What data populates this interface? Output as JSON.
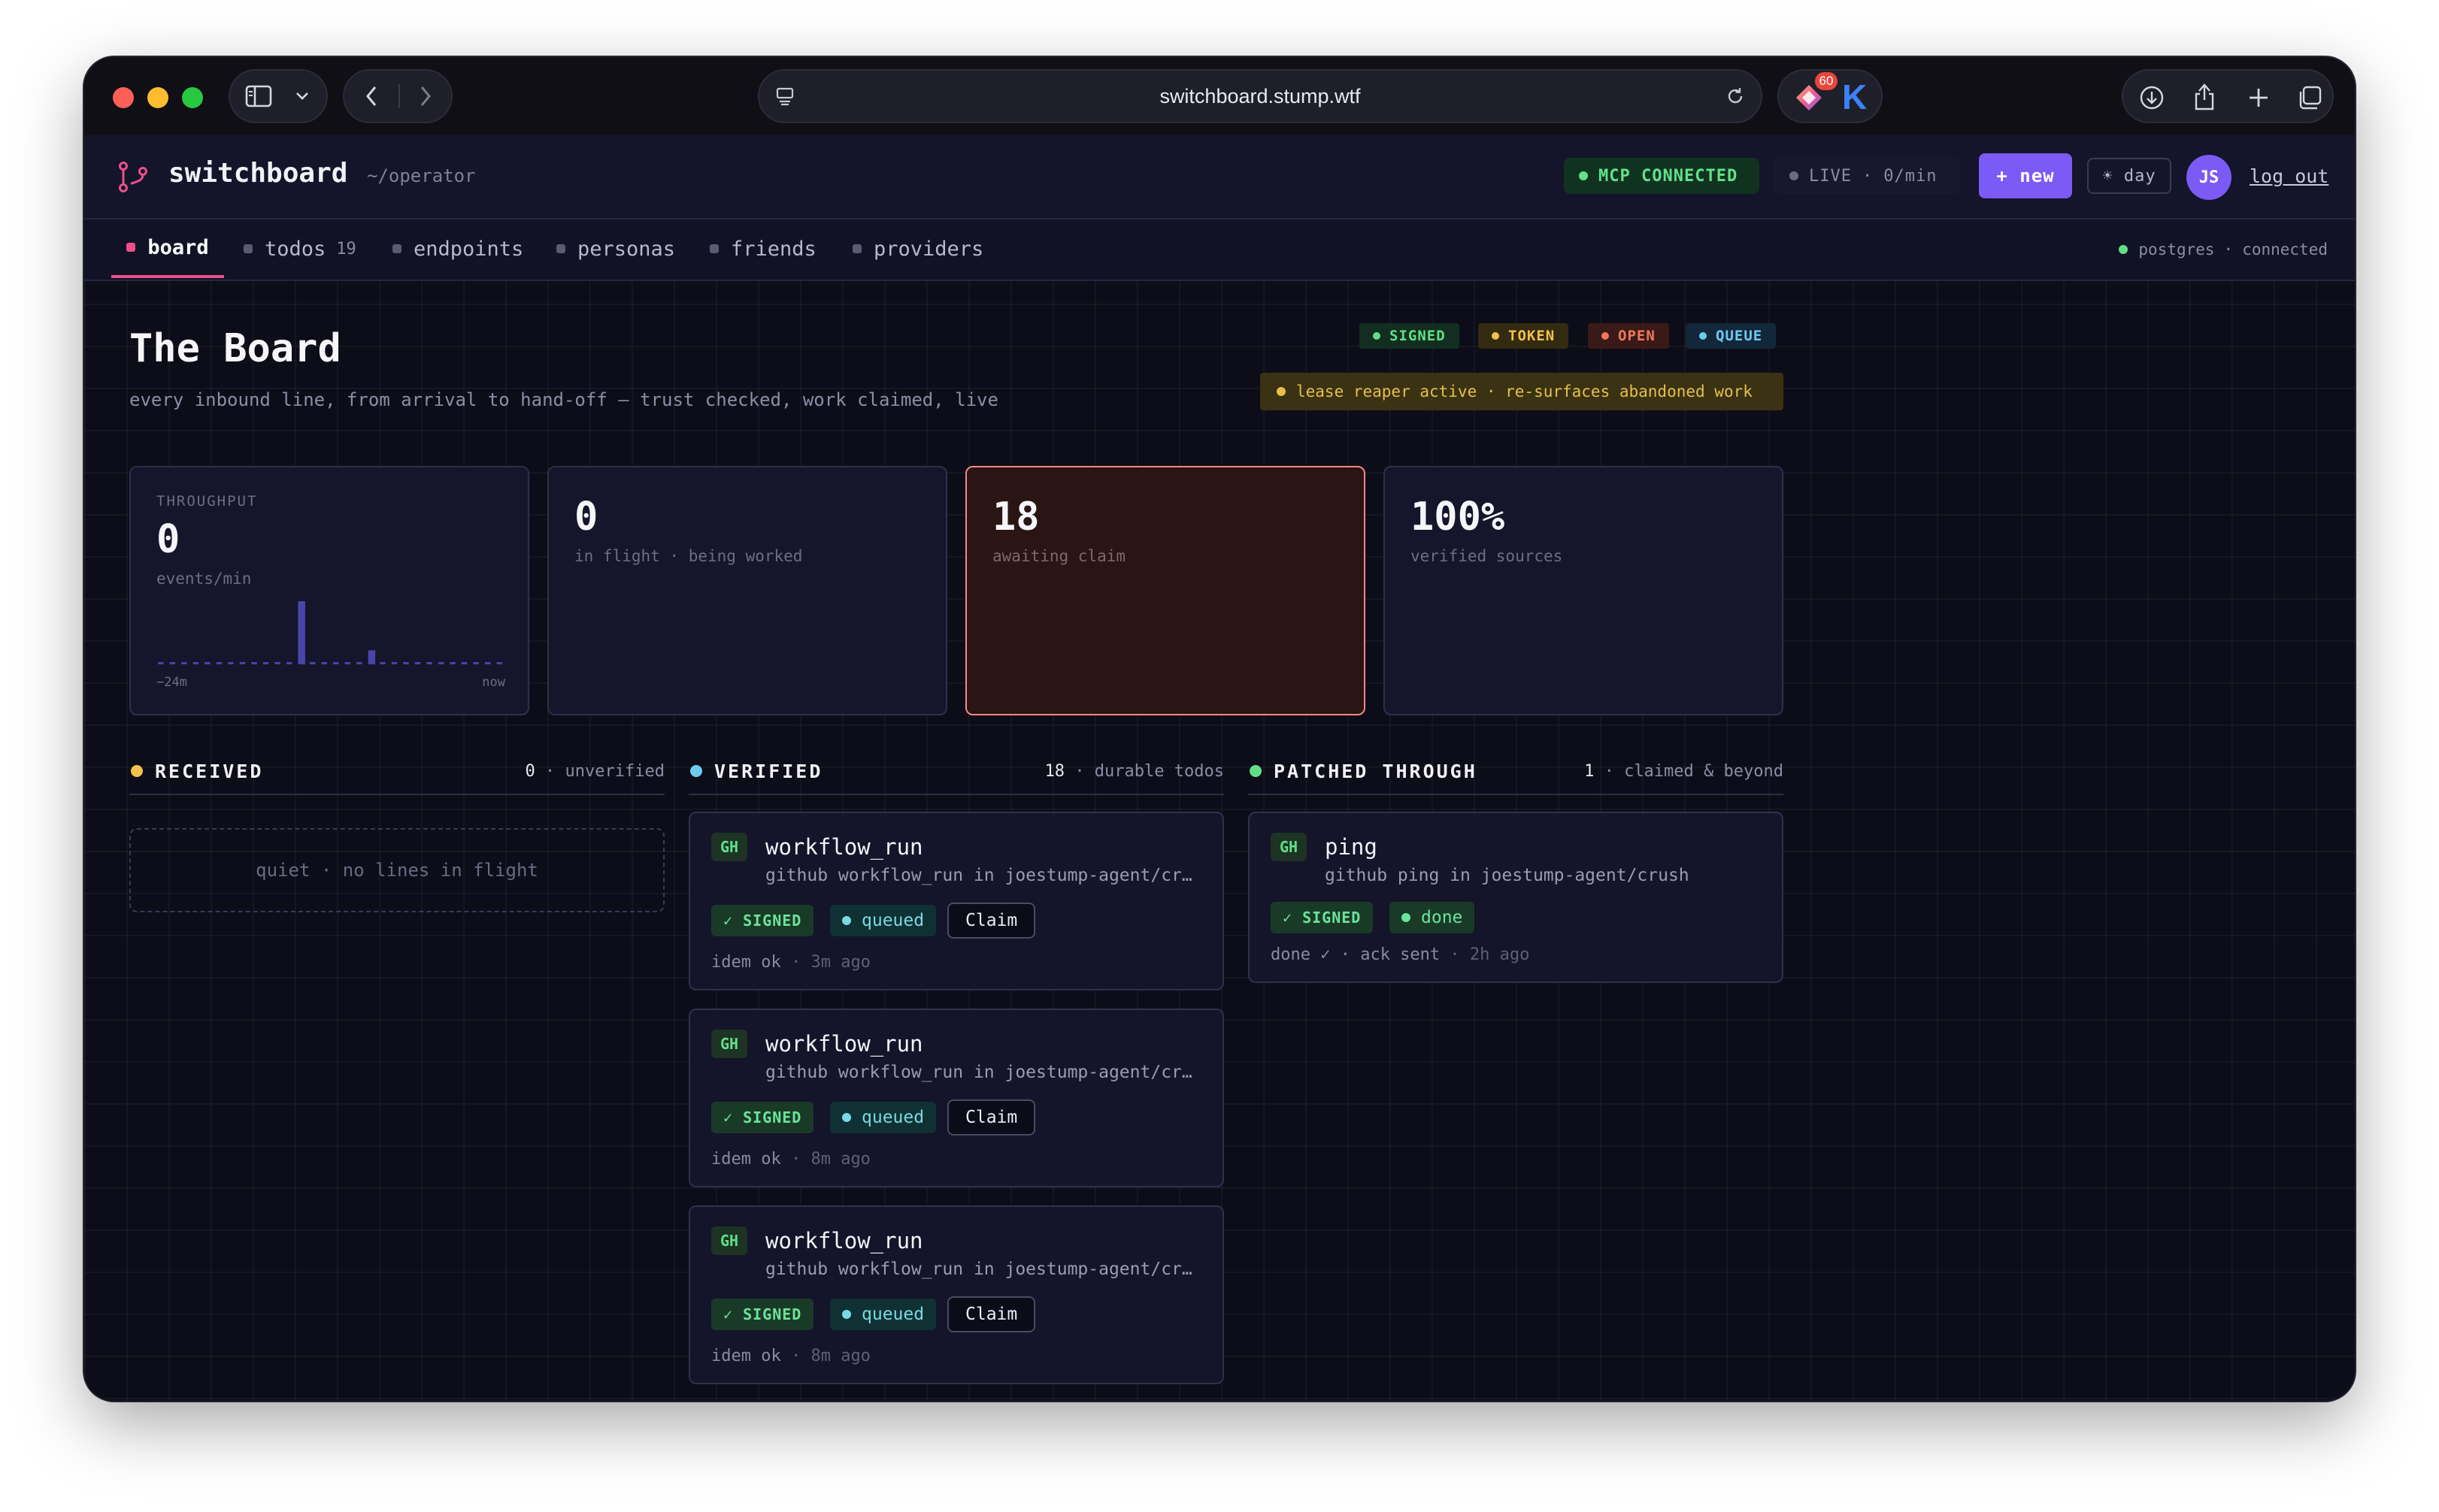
{
  "browser": {
    "url": "switchboard.stump.wtf",
    "extension_badge": "60",
    "extension_k": "K"
  },
  "header": {
    "app_name": "switchboard",
    "path": "~/operator",
    "mcp_status": "MCP CONNECTED",
    "live_label": "LIVE",
    "live_rate": "0/min",
    "live_sep": "·",
    "new_button": "+ new",
    "theme_button": "☀ day",
    "avatar_initials": "JS",
    "logout": "log out"
  },
  "tabs": [
    {
      "label": "board",
      "count": ""
    },
    {
      "label": "todos",
      "count": "19"
    },
    {
      "label": "endpoints",
      "count": ""
    },
    {
      "label": "personas",
      "count": ""
    },
    {
      "label": "friends",
      "count": ""
    },
    {
      "label": "providers",
      "count": ""
    }
  ],
  "db_status": {
    "name": "postgres",
    "sep": "·",
    "state": "connected"
  },
  "page": {
    "title": "The Board",
    "subtitle": "every inbound line, from arrival to hand-off — trust checked, work claimed, live"
  },
  "legend": [
    {
      "label": "SIGNED",
      "color": "#5fe087"
    },
    {
      "label": "TOKEN",
      "color": "#f2c14b"
    },
    {
      "label": "OPEN",
      "color": "#f0795d"
    },
    {
      "label": "QUEUE",
      "color": "#6ecbf0"
    }
  ],
  "notice": "lease reaper active · re-surfaces abandoned work",
  "stats": {
    "throughput": {
      "label": "THROUGHPUT",
      "value": "0",
      "unit": "events/min",
      "axis_start": "−24m",
      "axis_end": "now"
    },
    "in_flight": {
      "value": "0",
      "label": "in flight · being worked"
    },
    "awaiting": {
      "value": "18",
      "label": "awaiting claim"
    },
    "verified": {
      "value": "100%",
      "label": "verified sources"
    }
  },
  "sparkline": {
    "values": [
      0,
      0,
      0,
      0,
      0,
      0,
      0,
      0,
      0,
      0,
      0,
      0,
      9,
      0,
      0,
      0,
      0,
      0,
      2,
      0,
      0,
      0,
      0,
      0,
      0,
      0,
      0,
      0,
      0,
      0
    ],
    "color": "#4a43a8"
  },
  "columns": {
    "received": {
      "title": "RECEIVED",
      "count": "0",
      "label": "· unverified",
      "color": "#f2c14b",
      "empty": "quiet · no lines in flight"
    },
    "verified": {
      "title": "VERIFIED",
      "count": "18",
      "label": "· durable todos",
      "color": "#6ecbf0"
    },
    "patched": {
      "title": "PATCHED THROUGH",
      "count": "1",
      "label": "· claimed & beyond",
      "color": "#5fe087"
    }
  },
  "verified_cards": [
    {
      "source": "GH",
      "event": "workflow_run",
      "desc": "github workflow_run in joestump-agent/crush",
      "signed": "✓ SIGNED",
      "status": "queued",
      "action": "Claim",
      "idem": "idem ok",
      "age": "· 3m ago"
    },
    {
      "source": "GH",
      "event": "workflow_run",
      "desc": "github workflow_run in joestump-agent/crush",
      "signed": "✓ SIGNED",
      "status": "queued",
      "action": "Claim",
      "idem": "idem ok",
      "age": "· 8m ago"
    },
    {
      "source": "GH",
      "event": "workflow_run",
      "desc": "github workflow_run in joestump-agent/crush",
      "signed": "✓ SIGNED",
      "status": "queued",
      "action": "Claim",
      "idem": "idem ok",
      "age": "· 8m ago"
    }
  ],
  "patched_cards": [
    {
      "source": "GH",
      "event": "ping",
      "desc": "github ping in joestump-agent/crush",
      "signed": "✓ SIGNED",
      "status": "done",
      "foot": "done ✓ · ack sent",
      "age": "· 2h ago"
    }
  ]
}
